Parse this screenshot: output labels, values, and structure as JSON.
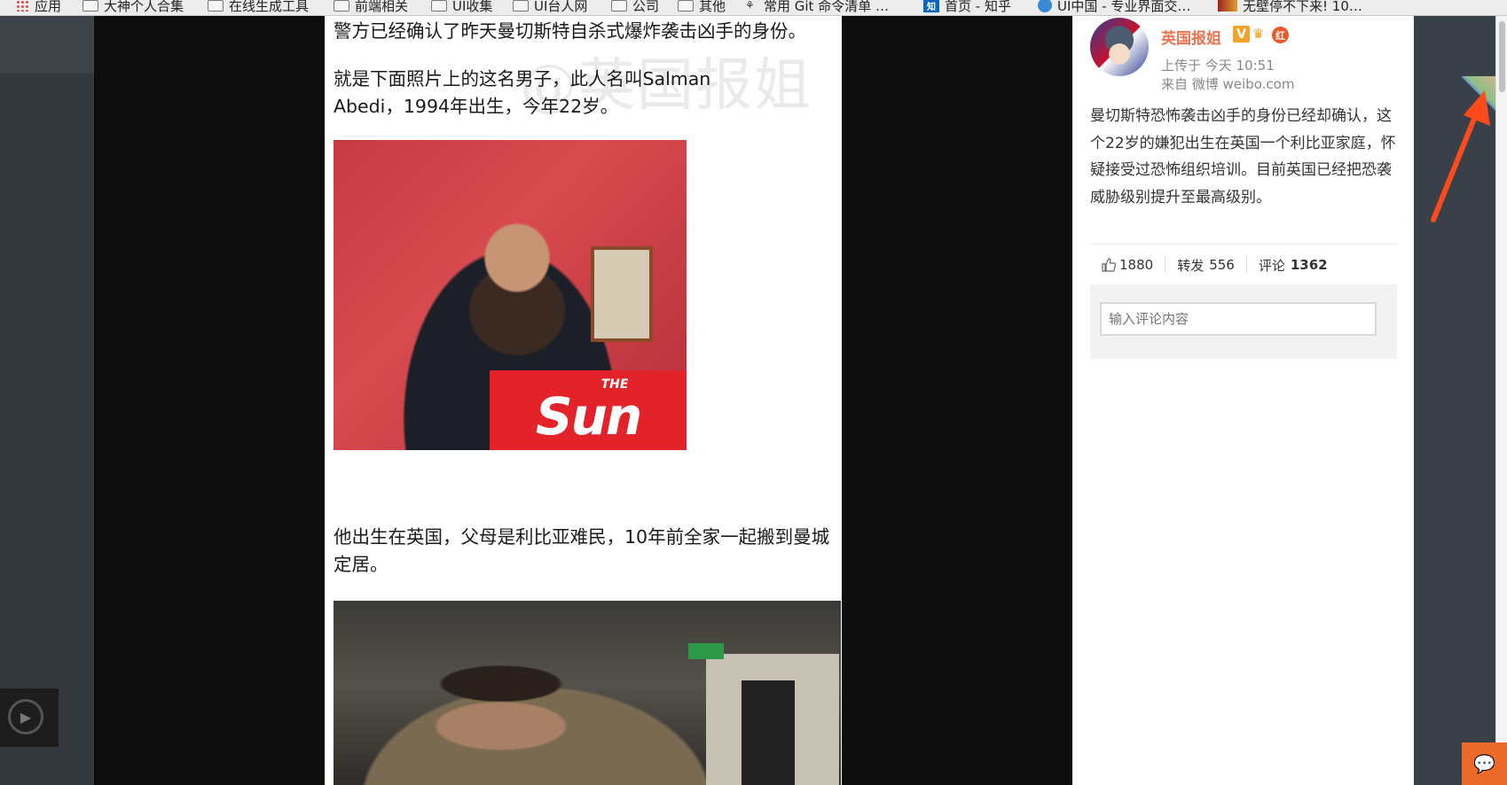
{
  "bookmarks_bar": {
    "items": [
      {
        "label": "应用",
        "icon": "apps-icon"
      },
      {
        "label": "大神个人合集",
        "icon": "folder-icon"
      },
      {
        "label": "在线生成工具",
        "icon": "folder-icon"
      },
      {
        "label": "前端相关",
        "icon": "folder-icon"
      },
      {
        "label": "UI收集",
        "icon": "folder-icon"
      },
      {
        "label": "UI台人网",
        "icon": "folder-icon"
      },
      {
        "label": "公司",
        "icon": "folder-icon"
      },
      {
        "label": "其他",
        "icon": "folder-icon"
      },
      {
        "label": "常用 Git 命令清单 …",
        "icon": "github-icon"
      },
      {
        "label": "首页 - 知乎",
        "icon": "zhihu-icon"
      },
      {
        "label": "UI中国 - 专业界面交…",
        "icon": "uichina-icon"
      },
      {
        "label": "无壁停不下来! 10…",
        "icon": "thumbnail-icon"
      }
    ]
  },
  "article": {
    "watermark": "@英国报姐",
    "paragraph1": "警方已经确认了昨天曼切斯特自杀式爆炸袭击凶手的身份。",
    "paragraph2": "就是下面照片上的这名男子，此人名叫Salman Abedi，1994年出生，今年22岁。",
    "image1_logo_the": "THE",
    "image1_logo_sun": "Sun",
    "paragraph3": "他出生在英国，父母是利比亚难民，10年前全家一起搬到曼城定居。"
  },
  "post": {
    "author": "英国报姐",
    "verified_badge": "V",
    "red_badge": "红",
    "upload_time": "上传于 今天 10:51",
    "source": "来自 微博 weibo.com",
    "text": "曼切斯特恐怖袭击凶手的身份已经却确认，这个22岁的嫌犯出生在英国一个利比亚家庭，怀疑接受过恐怖组织培训。目前英国已经把恐袭威胁级别提升至最高级别。",
    "likes": "1880",
    "repost_label": "转发",
    "repost_count": "556",
    "comment_label": "评论",
    "comment_count": "1362",
    "comment_placeholder": "输入评论内容"
  },
  "colors": {
    "author": "#eb7350",
    "stage": "#0d0d0d",
    "annotation_arrow": "#ff4a1c"
  }
}
